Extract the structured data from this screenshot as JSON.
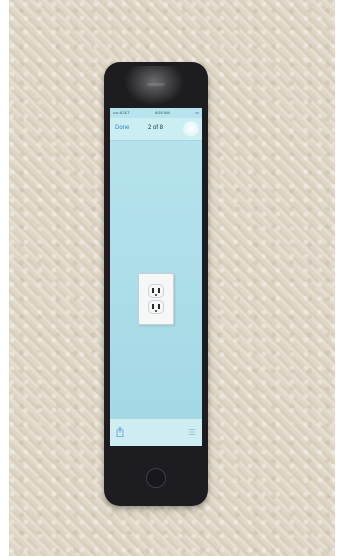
{
  "status_bar": {
    "carrier": "•••• AT&T",
    "time": "8:59 AM",
    "battery": "▭"
  },
  "nav": {
    "done_label": "Done",
    "title": "2 of 8"
  },
  "photo": {
    "subject": "electrical outlet"
  },
  "toolbar": {
    "share_icon": "share-icon",
    "list_icon": "list-icon"
  },
  "colors": {
    "screen_bg": "#abdde9",
    "nav_tint": "#2d7fd0",
    "phone_body": "#1d1d21",
    "carpet": "#e0d8c8"
  }
}
